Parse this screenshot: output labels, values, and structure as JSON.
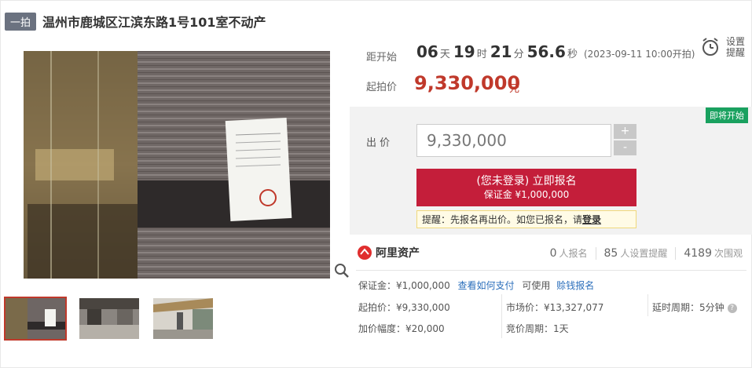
{
  "header": {
    "tag": "一拍",
    "title": "温州市鹿城区江滨东路1号101室不动产"
  },
  "countdown": {
    "label": "距开始",
    "days": "06",
    "days_unit": "天",
    "hours": "19",
    "hours_unit": "时",
    "minutes": "21",
    "minutes_unit": "分",
    "seconds": "56.6",
    "seconds_unit": "秒",
    "start_time": "(2023-09-11 10:00开拍)"
  },
  "start_price": {
    "label": "起拍价",
    "value": "9,330,000",
    "unit": "元"
  },
  "remind": {
    "line1": "设置",
    "line2": "提醒",
    "icon": "alarm-clock-icon"
  },
  "bid": {
    "status_badge": "即将开始",
    "label": "出  价",
    "input_value": "9,330,000",
    "plus": "+",
    "minus": "-",
    "signup_main": "(您未登录) 立即报名",
    "signup_sub": "保证金 ¥1,000,000",
    "tip_text": "提醒：先报名再出价。如您已报名，请",
    "tip_link": "登录"
  },
  "info": {
    "brand": "阿里资产",
    "signups_count": "0",
    "signups_label": "人报名",
    "reminders_count": "85",
    "reminders_label": "人设置提醒",
    "views_count": "4189",
    "views_label": "次围观",
    "deposit_text": "保证金：¥1,000,000",
    "how_to_pay": "查看如何支付",
    "can_use": "可使用",
    "credit_signup": "赊钱报名",
    "start_price_text": "起拍价：¥9,330,000",
    "market_price_text": "市场价：¥13,327,077",
    "delay_text": "延时周期：5分钟",
    "increment_text": "加价幅度：¥20,000",
    "auction_period_text": "竞价周期：1天"
  },
  "colors": {
    "accent_red": "#c41e3a",
    "price_red": "#c0392b",
    "status_green": "#19a15f",
    "link_blue": "#2a6ebb"
  }
}
